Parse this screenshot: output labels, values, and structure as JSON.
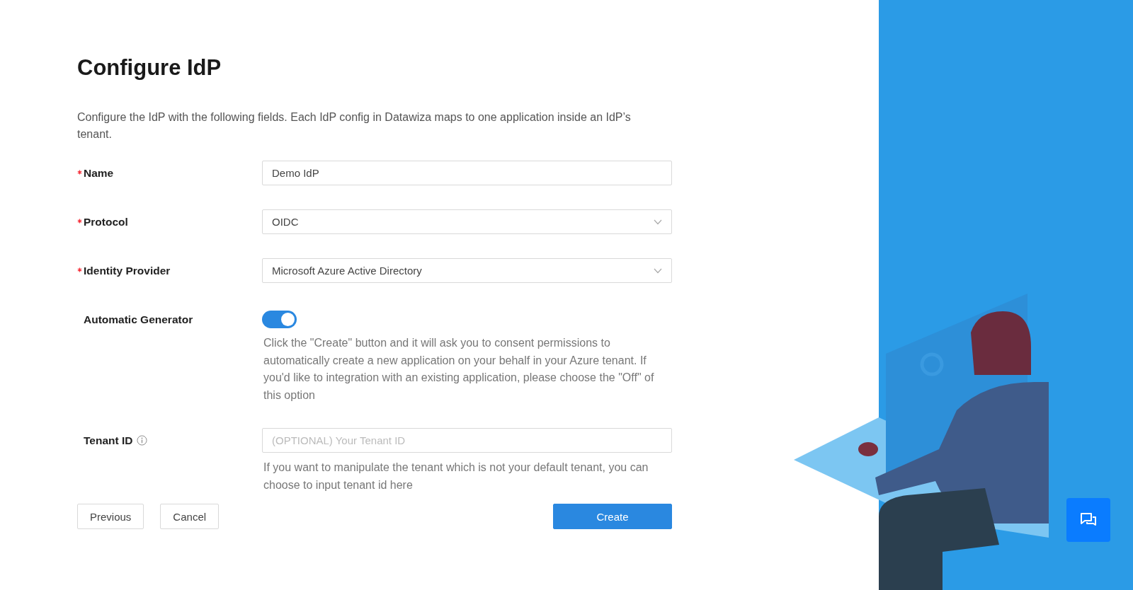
{
  "title": "Configure IdP",
  "description": "Configure the IdP with the following fields. Each IdP config in Datawiza maps to one application inside an IdP’s tenant.",
  "fields": [
    {
      "kind": "input",
      "label": "Name",
      "required": true,
      "value": "Demo IdP"
    },
    {
      "kind": "select",
      "label": "Protocol",
      "required": true,
      "value": "OIDC"
    },
    {
      "kind": "select",
      "label": "Identity Provider",
      "required": true,
      "value": "Microsoft Azure Active Directory"
    },
    {
      "kind": "switch",
      "label": "Automatic Generator",
      "required": false,
      "on": true,
      "help": "Click the \"Create\" button and it will ask you to consent permissions to automatically create a new application on your behalf in your Azure tenant. If you'd like to integration with an existing application, please choose the \"Off\" of this option"
    },
    {
      "kind": "input",
      "label": "Tenant ID",
      "required": false,
      "info": true,
      "placeholder": "(OPTIONAL) Your Tenant ID",
      "help": "If you want to manipulate the tenant which is not your default tenant, you can choose to input tenant id here"
    }
  ],
  "buttons": [
    {
      "label": "Previous",
      "kind": "default"
    },
    {
      "label": "Cancel",
      "kind": "default"
    },
    {
      "label": "Create",
      "kind": "primary"
    }
  ]
}
